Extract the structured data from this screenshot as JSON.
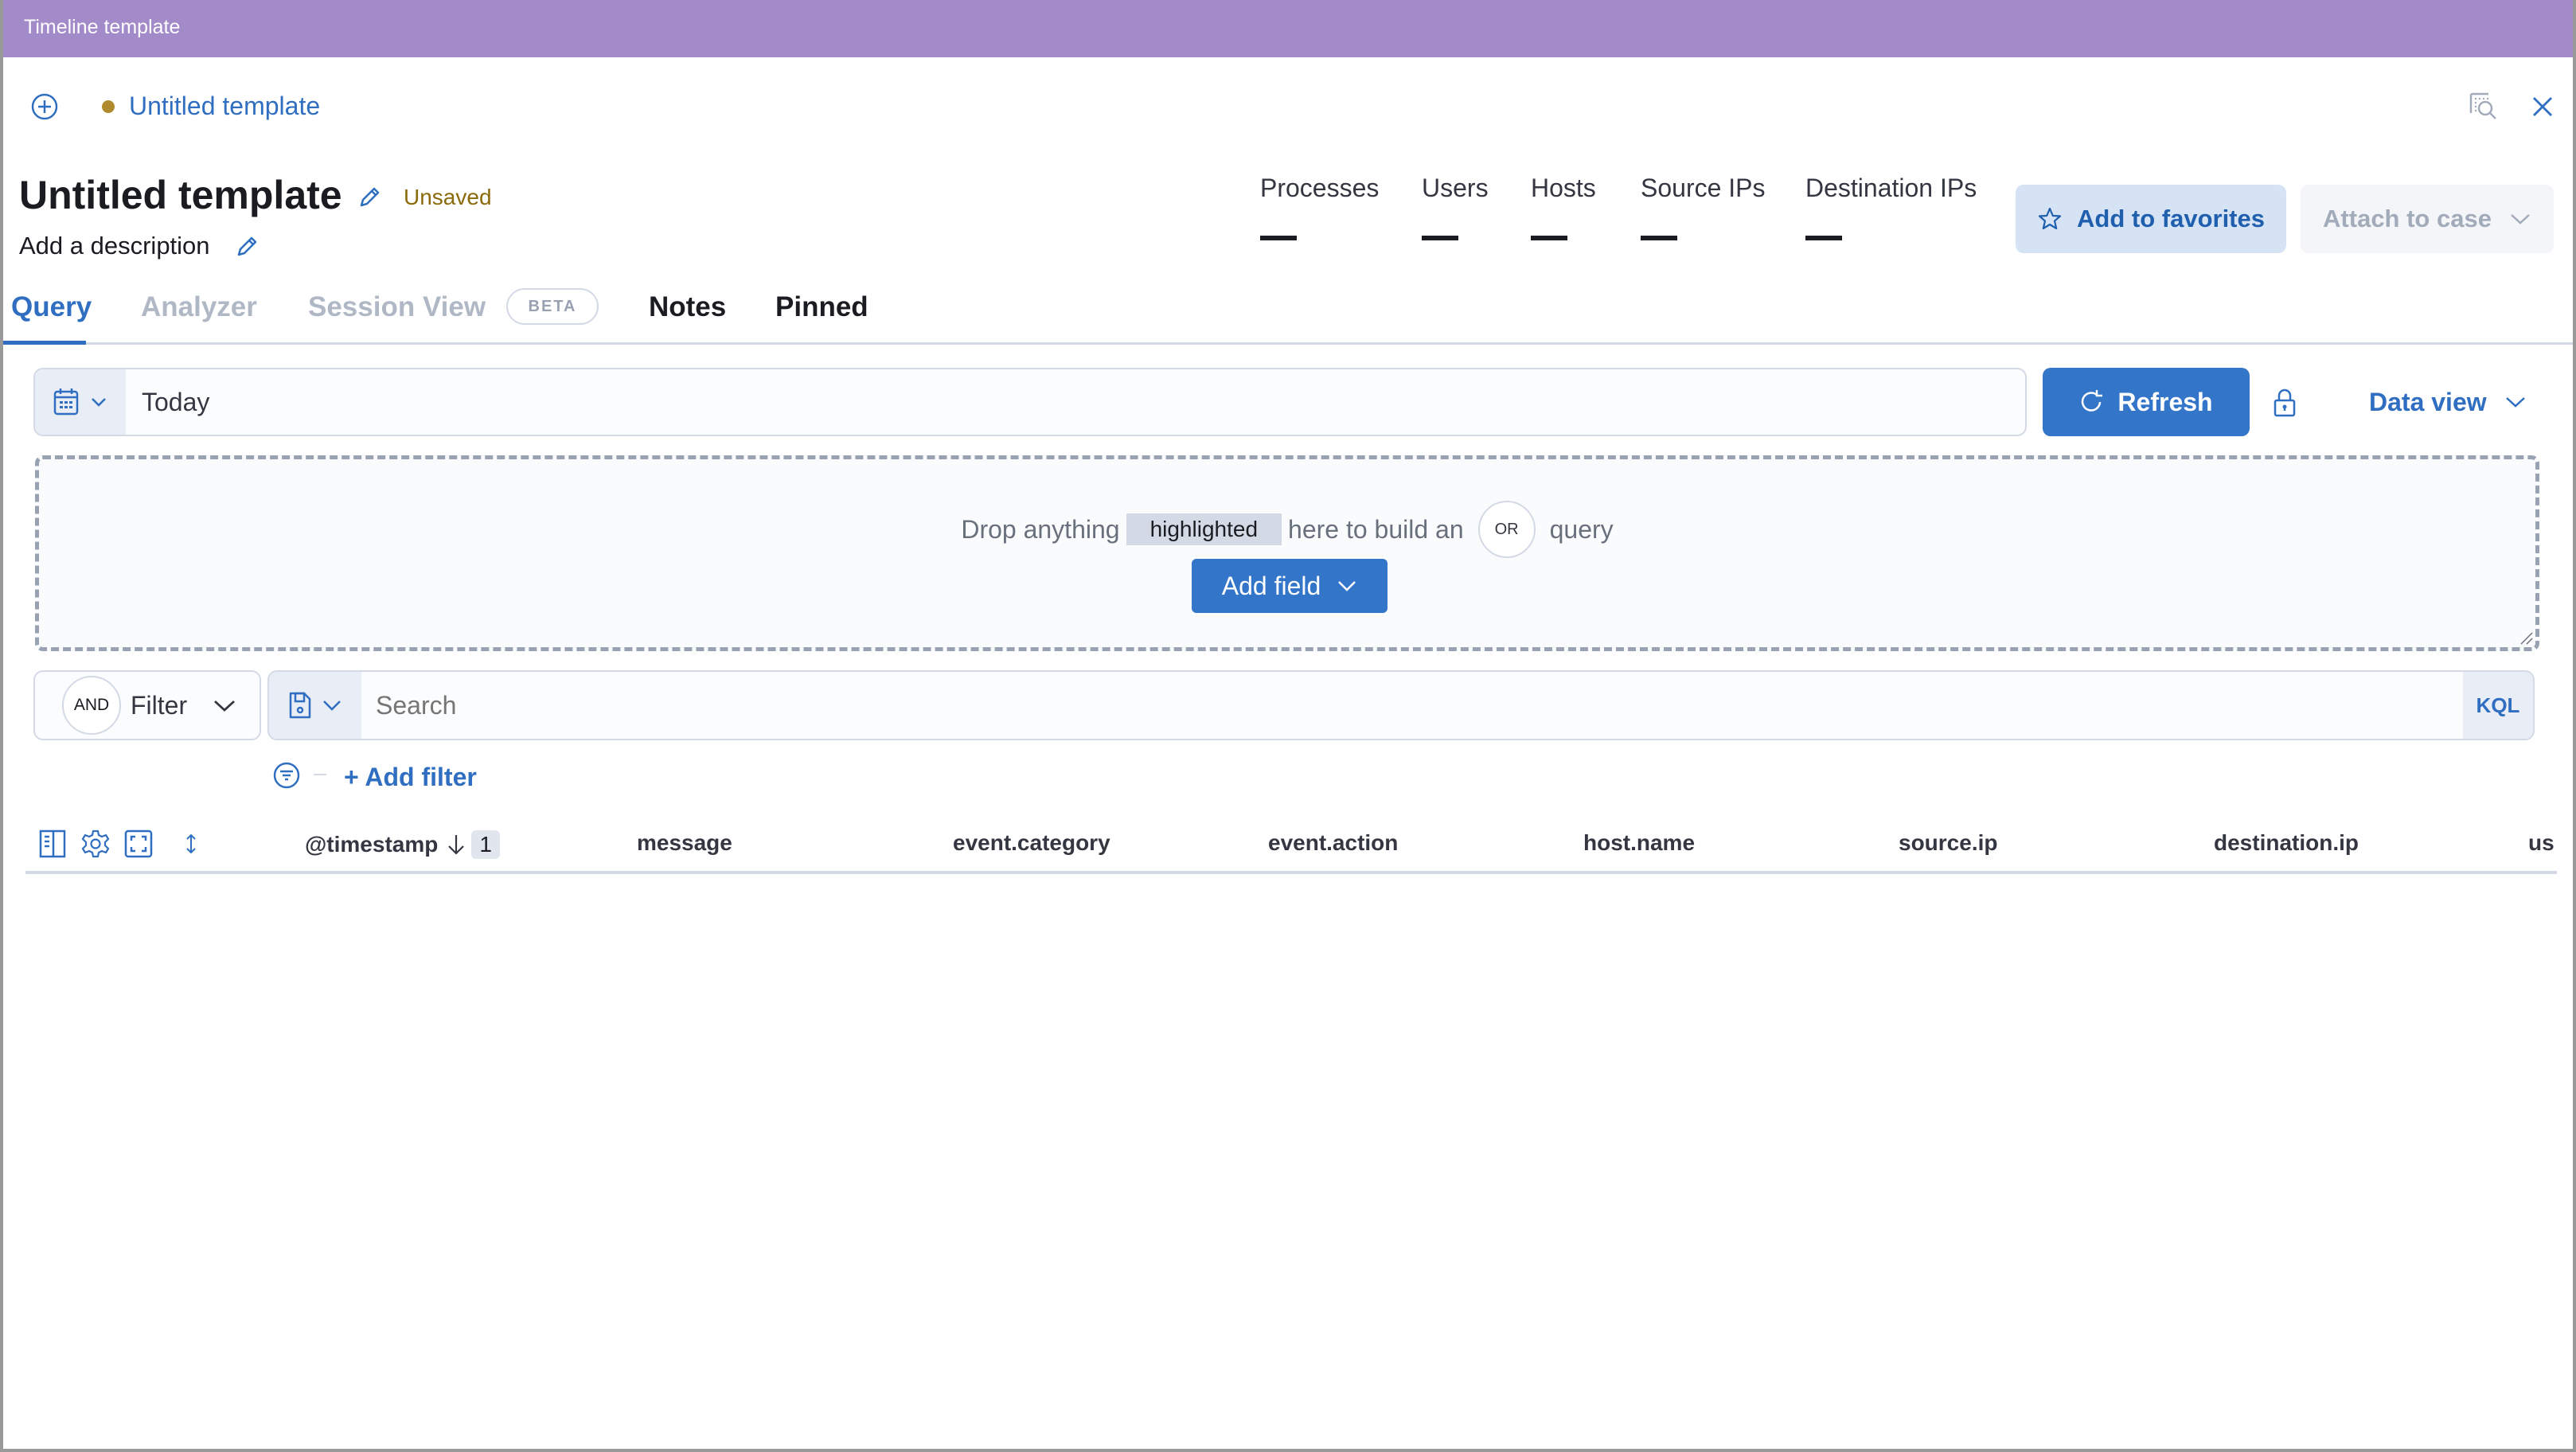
{
  "window": {
    "title": "Timeline template"
  },
  "header": {
    "add_icon": "plus-circle-icon",
    "breadcrumb_title": "Untitled template",
    "status_dot_color": "#b08a2e",
    "inspect_icon": "inspect-icon",
    "close_icon": "close-icon"
  },
  "title_section": {
    "title": "Untitled template",
    "status": "Unsaved",
    "description_placeholder": "Add a description",
    "edit_icon": "pencil-icon"
  },
  "stats": [
    {
      "label": "Processes",
      "value": "—"
    },
    {
      "label": "Users",
      "value": "—"
    },
    {
      "label": "Hosts",
      "value": "—"
    },
    {
      "label": "Source IPs",
      "value": "—"
    },
    {
      "label": "Destination IPs",
      "value": "—"
    }
  ],
  "actions": {
    "favorites_label": "Add to favorites",
    "favorites_icon": "star-icon",
    "attach_label": "Attach to case",
    "attach_icon": "chevron-down-icon"
  },
  "tabs": [
    {
      "label": "Query",
      "state": "active"
    },
    {
      "label": "Analyzer",
      "state": "disabled"
    },
    {
      "label": "Session View",
      "state": "disabled",
      "badge": "BETA"
    },
    {
      "label": "Notes",
      "state": "normal"
    },
    {
      "label": "Pinned",
      "state": "normal"
    }
  ],
  "date_picker": {
    "icon": "calendar-icon",
    "value": "Today"
  },
  "refresh": {
    "label": "Refresh",
    "icon": "refresh-icon"
  },
  "lock_icon": "lock-icon",
  "data_view": {
    "label": "Data view"
  },
  "drop_zone": {
    "text_before": "Drop anything",
    "highlight": "highlighted",
    "text_middle": "here to build an",
    "operator": "OR",
    "text_after": "query",
    "add_field_label": "Add field"
  },
  "filter_bar": {
    "operator": "AND",
    "filter_label": "Filter",
    "search_placeholder": "Search",
    "language": "KQL",
    "add_filter_label": "+ Add filter"
  },
  "table": {
    "columns": [
      {
        "label": "@timestamp",
        "sort": "desc",
        "sort_index": "1"
      },
      {
        "label": "message"
      },
      {
        "label": "event.category"
      },
      {
        "label": "event.action"
      },
      {
        "label": "host.name"
      },
      {
        "label": "source.ip"
      },
      {
        "label": "destination.ip"
      },
      {
        "label": "us"
      }
    ]
  },
  "colors": {
    "accent": "#3375c9",
    "titlebar": "#a38ac9",
    "unsaved": "#8a6a0a"
  }
}
